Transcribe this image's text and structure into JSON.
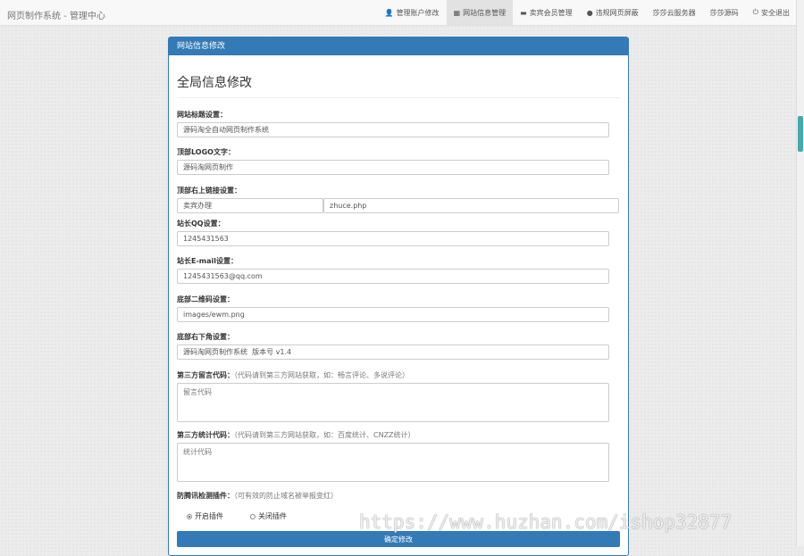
{
  "brand": "网页制作系统 - 管理中心",
  "nav": [
    {
      "icon": "user-icon",
      "glyph": "👤",
      "label": "管理账户修改",
      "active": false
    },
    {
      "icon": "table-icon",
      "glyph": "▦",
      "label": "网站信息管理",
      "active": true
    },
    {
      "icon": "comment-icon",
      "glyph": "▬",
      "label": "卖宾会员管理",
      "active": false
    },
    {
      "icon": "alert-icon",
      "glyph": "●",
      "label": "违规网页屏蔽",
      "active": false
    },
    {
      "icon": "",
      "glyph": "",
      "label": "莎莎云服务器",
      "active": false
    },
    {
      "icon": "",
      "glyph": "",
      "label": "莎莎源码",
      "active": false
    },
    {
      "icon": "power-icon",
      "glyph": "⏻",
      "label": "安全退出",
      "active": false
    }
  ],
  "panel": {
    "heading": "网站信息修改",
    "title": "全局信息修改"
  },
  "form": {
    "site_title_label": "网站标题设置：",
    "site_title_value": "源码淘全自动网页制作系统",
    "logo_label": "顶部LOGO文字：",
    "logo_value": "源码淘网页制作",
    "toplink_label": "顶部右上链接设置：",
    "toplink_text": "卖宾办理",
    "toplink_url": "zhuce.php",
    "qq_label": "站长QQ设置：",
    "qq_value": "1245431563",
    "email_label": "站长E-mail设置：",
    "email_value": "1245431563@qq.com",
    "qr_label": "底部二维码设置：",
    "qr_value": "images/ewm.png",
    "footer_label": "底部右下角设置：",
    "footer_value": "源码淘网页制作系统  版本号 v1.4",
    "comment_label": "第三方留言代码：",
    "comment_hint": "（代码请到第三方网站获取，如：畅言评论、多说评论）",
    "comment_placeholder": "留言代码",
    "stats_label": "第三方统计代码：",
    "stats_hint": "（代码请到第三方网站获取，如：百度统计、CNZZ统计）",
    "stats_placeholder": "统计代码",
    "plugin_label": "防腾讯检测插件：",
    "plugin_hint": "（可有效的防止域名被举报变红）",
    "plugin_on": "开启插件",
    "plugin_off": "关闭插件",
    "submit": "确定修改"
  },
  "watermark": "https://www.huzhan.com/ishop32877"
}
